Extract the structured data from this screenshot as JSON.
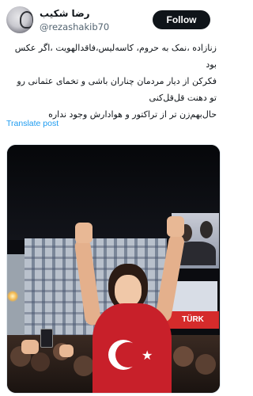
{
  "author": {
    "name": "رضا شکیب",
    "handle": "@rezashakib70"
  },
  "follow_label": "Follow",
  "tweet_lines": [
    "زنازاده ،نمک به حروم، کاسه‌لیس،فاقدالهویت ،اگر عکس",
    "بود",
    "فکرکن از دیار مردمان چناران باشی و تخمای عثمانی رو",
    "تو دهنت قل‌قل‌کنی",
    "حال‌بهم‌زن تر از تراکتور و هوادارش وجود نداره"
  ],
  "translate_label": "Translate post",
  "media": {
    "banner_text": "TÜRK"
  },
  "icons": {
    "avatar": "profile-avatar",
    "flag_star": "star-icon"
  },
  "colors": {
    "follow_bg": "#0f1419",
    "link": "#1d9bf0",
    "flag_red": "#c8202a"
  }
}
